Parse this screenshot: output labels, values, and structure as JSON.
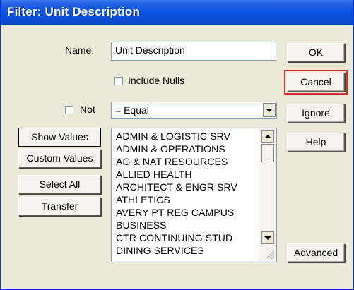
{
  "window": {
    "title": "Filter: Unit Description"
  },
  "name_field": {
    "label": "Name:",
    "value": "Unit Description"
  },
  "include_nulls": {
    "label": "Include Nulls",
    "checked": false
  },
  "not_option": {
    "label": "Not",
    "checked": false
  },
  "operator": {
    "selected": "= Equal"
  },
  "left_buttons": {
    "show_values": "Show Values",
    "custom_values": "Custom Values",
    "select_all": "Select All",
    "transfer": "Transfer"
  },
  "values_list": {
    "items": [
      "ADMIN & LOGISTIC SRV",
      "ADMIN & OPERATIONS",
      "AG & NAT RESOURCES",
      "ALLIED HEALTH",
      "ARCHITECT & ENGR SRV",
      "ATHLETICS",
      "AVERY PT REG CAMPUS",
      "BUSINESS",
      "CTR CONTINUING STUD",
      "DINING SERVICES"
    ]
  },
  "right_buttons": {
    "ok": "OK",
    "cancel": "Cancel",
    "ignore": "Ignore",
    "help": "Help",
    "advanced": "Advanced"
  },
  "highlight_color": "#d43030"
}
